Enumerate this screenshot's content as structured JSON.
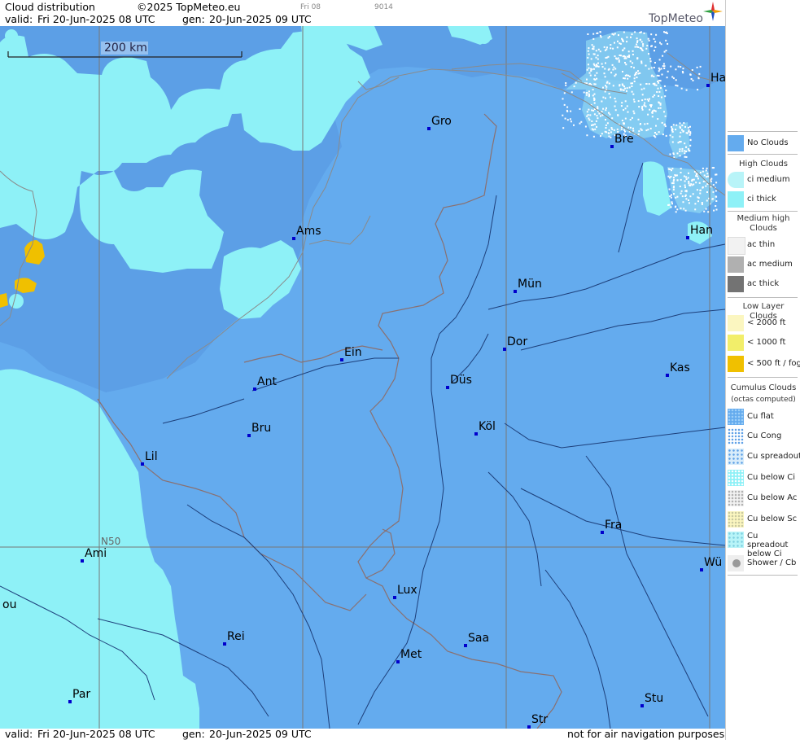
{
  "header": {
    "title": "Cloud distribution",
    "copyright": "©2025 TopMeteo.eu",
    "timestamp_small": "Fri 08",
    "code": "9014",
    "valid_label": "valid:",
    "valid_value": "Fri  20-Jun-2025  08 UTC",
    "gen_label": "gen:",
    "gen_value": "20-Jun-2025 09 UTC",
    "brand": "TopMeteo"
  },
  "footer": {
    "valid_label": "valid:",
    "valid_value": "Fri  20-Jun-2025  08 UTC",
    "gen_label": "gen:",
    "gen_value": "20-Jun-2025 09 UTC",
    "disclaimer": "not for air navigation purposes"
  },
  "map": {
    "scale_label": "200 km",
    "grid_label": "N50",
    "colors": {
      "no_clouds": "#64abee",
      "ci_thick": "#8ef1f7",
      "water": "#5b94dc",
      "low_cloud": "#f0c000",
      "coast": "#8a8a8a",
      "border": "#8a7070",
      "river": "#1d3f7a",
      "grid": "#777777"
    },
    "cities": [
      {
        "name": "Gro"
      },
      {
        "name": "Bre"
      },
      {
        "name": "Ha"
      },
      {
        "name": "Ams"
      },
      {
        "name": "Han"
      },
      {
        "name": "Mün"
      },
      {
        "name": "Dor"
      },
      {
        "name": "Ein"
      },
      {
        "name": "Ant"
      },
      {
        "name": "Düs"
      },
      {
        "name": "Kas"
      },
      {
        "name": "Bru"
      },
      {
        "name": "Köl"
      },
      {
        "name": "Lil"
      },
      {
        "name": "Fra"
      },
      {
        "name": "Ami"
      },
      {
        "name": "Lux"
      },
      {
        "name": "Wü"
      },
      {
        "name": "ou"
      },
      {
        "name": "Rei"
      },
      {
        "name": "Saa"
      },
      {
        "name": "Met"
      },
      {
        "name": "Par"
      },
      {
        "name": "Stu"
      },
      {
        "name": "Str"
      }
    ]
  },
  "legend": {
    "no_clouds": "No Clouds",
    "high_header": "High Clouds",
    "ci_medium": "ci medium",
    "ci_thick": "ci thick",
    "medium_header": "Medium high Clouds",
    "ac_thin": "ac thin",
    "ac_medium": "ac medium",
    "ac_thick": "ac thick",
    "low_header": "Low Layer Clouds",
    "low_2000": "< 2000 ft",
    "low_1000": "< 1000 ft",
    "low_500": "< 500 ft / fog",
    "cu_header": "Cumulus Clouds",
    "cu_sub": "(octas computed)",
    "cu_flat": "Cu flat",
    "cu_cong": "Cu Cong",
    "cu_spreadout": "Cu spreadout",
    "cu_below_ci": "Cu below Ci",
    "cu_below_ac": "Cu below Ac",
    "cu_below_sc": "Cu below Sc",
    "cu_spreadout_below_ci": "Cu spreadout below Ci",
    "shower": "Shower / Cb"
  }
}
